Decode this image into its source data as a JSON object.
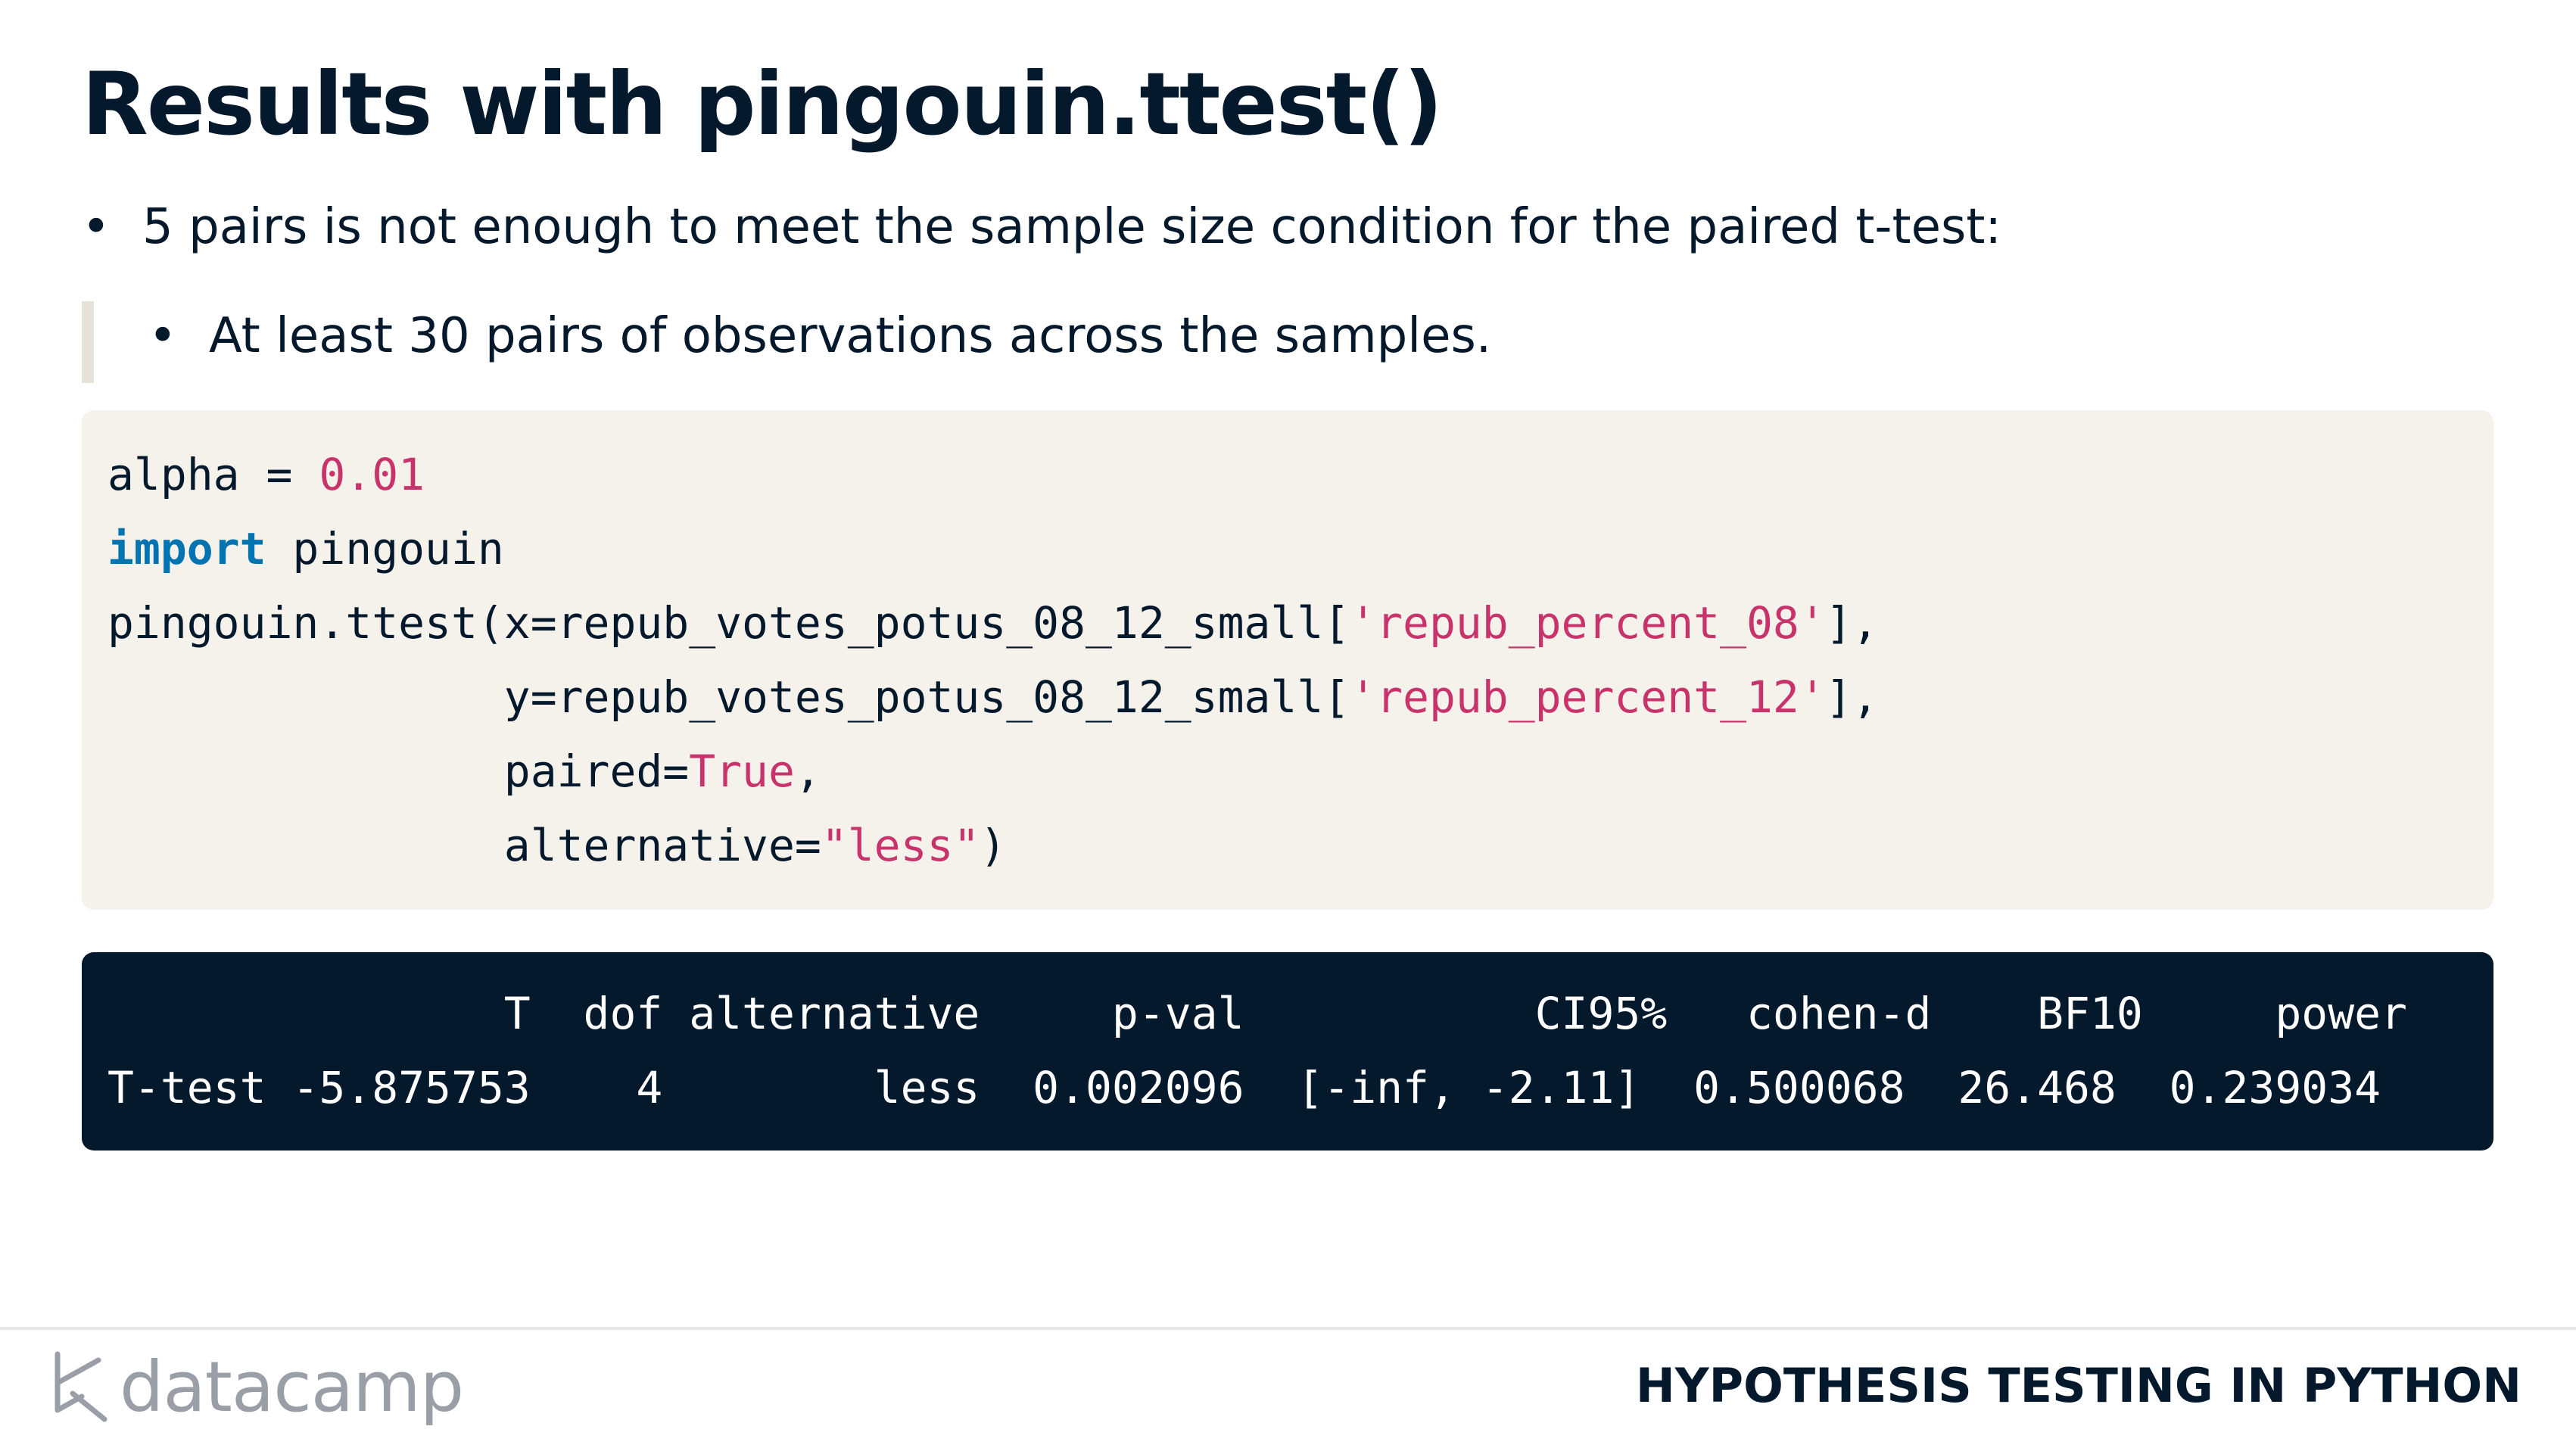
{
  "slide": {
    "title": "Results with pingouin.ttest()"
  },
  "bullets": {
    "level1": "5 pairs is not enough to meet the sample size condition for the paired t-test:",
    "level2": "At least 30 pairs of observations across the samples."
  },
  "code": {
    "line1_var": "alpha = ",
    "line1_num": "0.01",
    "line2_kw": "import",
    "line2_rest": " pingouin",
    "line3_pre": "pingouin.ttest(x=repub_votes_potus_08_12_small[",
    "line3_str": "'repub_percent_08'",
    "line3_post": "],",
    "line4_pre": "               y=repub_votes_potus_08_12_small[",
    "line4_str": "'repub_percent_12'",
    "line4_post": "],",
    "line5_pre": "               paired=",
    "line5_val": "True",
    "line5_post": ",",
    "line6_pre": "               alternative=",
    "line6_str": "\"less\"",
    "line6_post": ")"
  },
  "output": {
    "header": "               T  dof alternative     p-val           CI95%   cohen-d    BF10     power",
    "row": "T-test -5.875753    4        less  0.002096  [-inf, -2.11]  0.500068  26.468  0.239034"
  },
  "footer": {
    "logo_text": "datacamp",
    "course_title": "HYPOTHESIS TESTING IN PYTHON"
  },
  "colors": {
    "navy": "#05192d",
    "code_bg": "#f5f2ec",
    "keyword": "#0073b1",
    "literal": "#c8336c"
  }
}
